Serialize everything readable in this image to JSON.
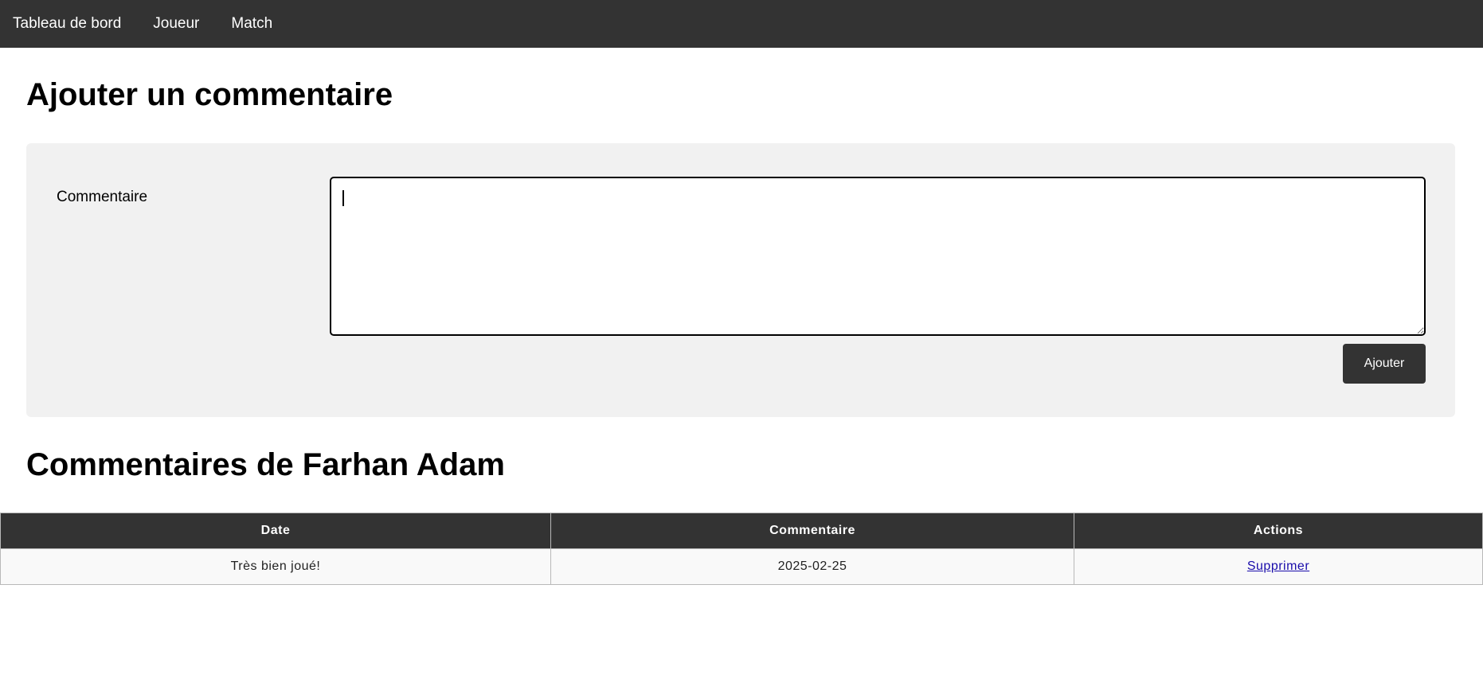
{
  "nav": {
    "items": [
      {
        "label": "Tableau de bord"
      },
      {
        "label": "Joueur"
      },
      {
        "label": "Match"
      }
    ]
  },
  "form": {
    "title": "Ajouter un commentaire",
    "label": "Commentaire",
    "textarea_value": "",
    "submit_label": "Ajouter"
  },
  "comments": {
    "title": "Commentaires de Farhan Adam",
    "columns": [
      "Date",
      "Commentaire",
      "Actions"
    ],
    "rows": [
      {
        "date": "Très bien joué!",
        "comment": "2025-02-25",
        "action": "Supprimer"
      }
    ]
  },
  "colors": {
    "nav_bg": "#333333",
    "panel_bg": "#f1f1f1",
    "button_bg": "#333333",
    "link": "#1a0dab"
  }
}
